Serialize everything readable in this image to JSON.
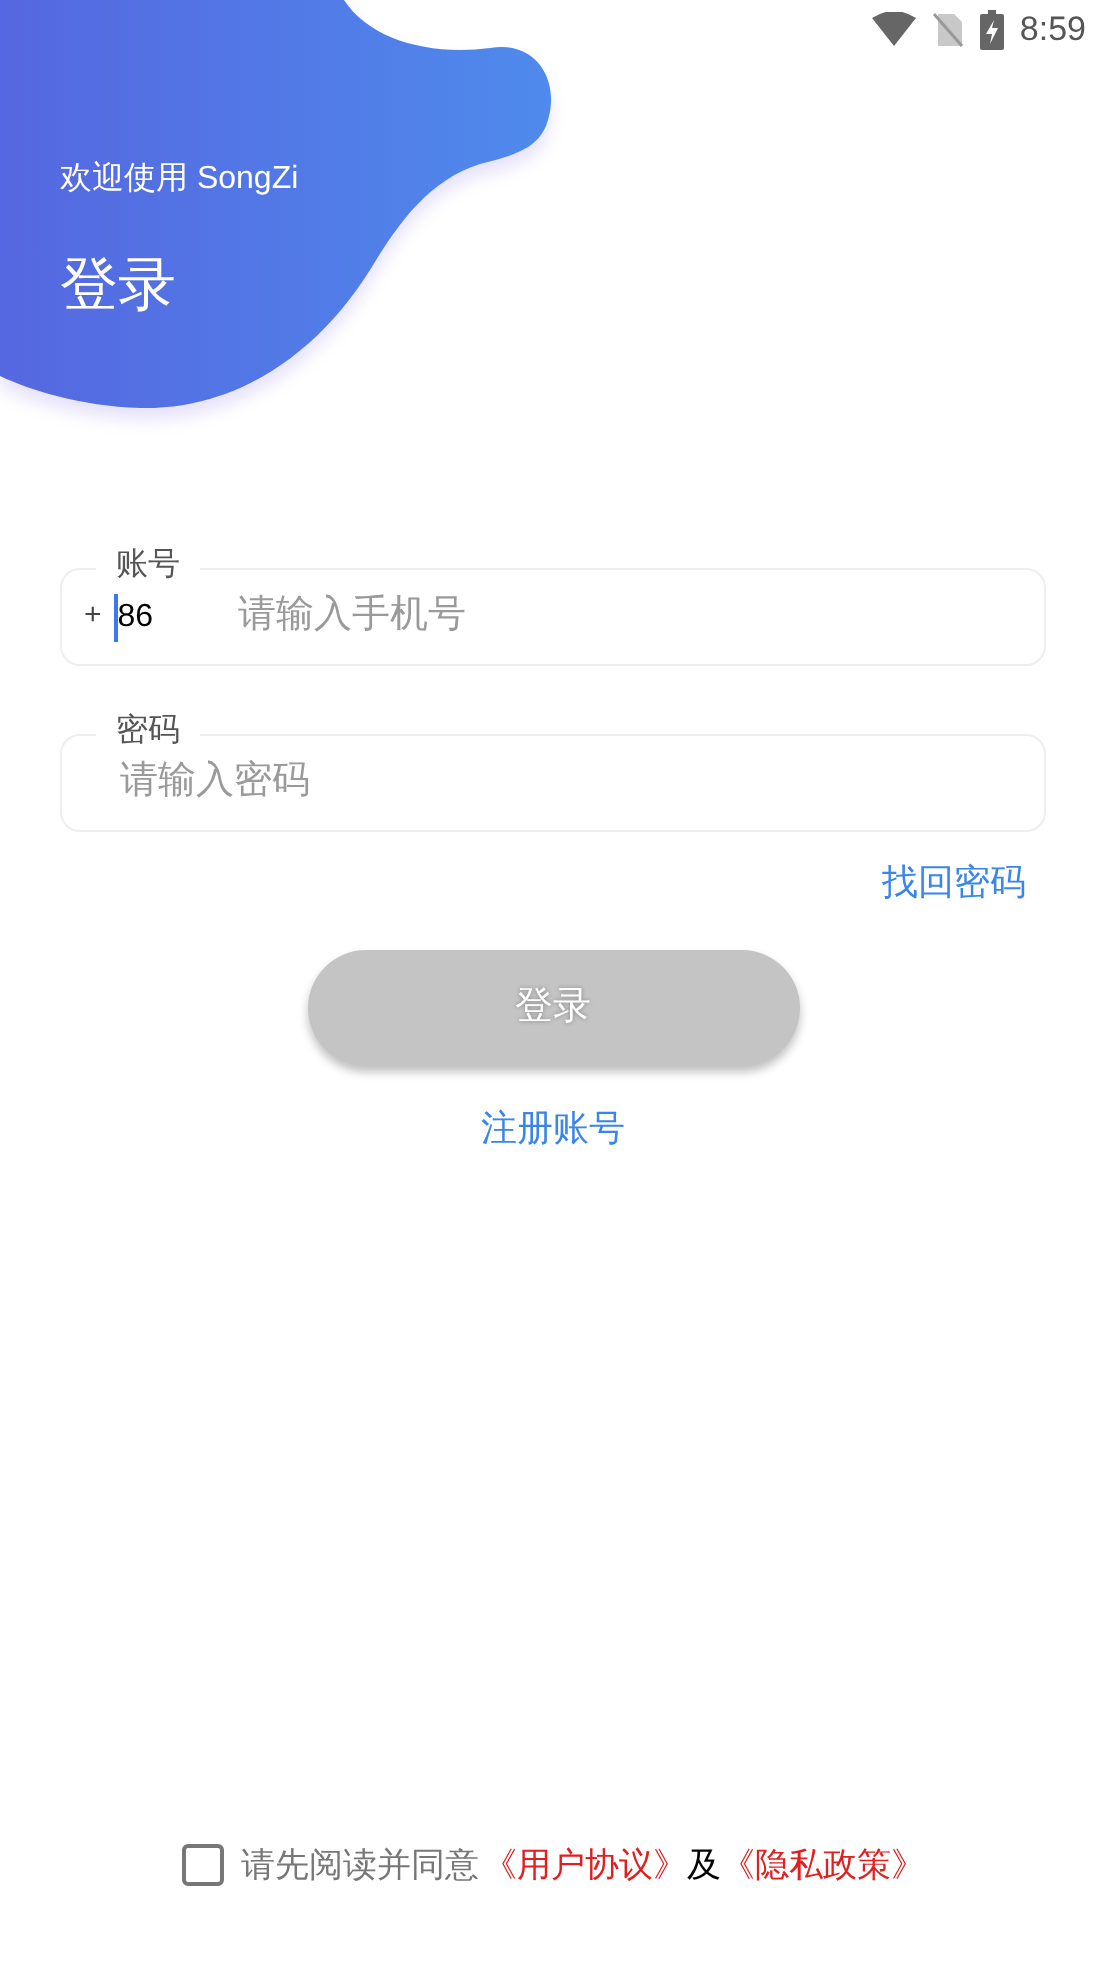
{
  "status_bar": {
    "time": "8:59"
  },
  "header": {
    "greeting": "欢迎使用 SongZi",
    "title": "登录"
  },
  "account_field": {
    "label": "账号",
    "prefix": "+",
    "country_code": "86",
    "placeholder": "请输入手机号"
  },
  "password_field": {
    "label": "密码",
    "placeholder": "请输入密码"
  },
  "forgot_link": "找回密码",
  "login_button": {
    "label": "登录",
    "disabled": true
  },
  "register_link": "注册账号",
  "agreement": {
    "checked": false,
    "parts": [
      {
        "kind": "text",
        "text": "请先阅读并同意"
      },
      {
        "kind": "link",
        "text": "《用户协议》"
      },
      {
        "kind": "plain",
        "text": "及"
      },
      {
        "kind": "link",
        "text": "《隐私政策》"
      }
    ]
  }
}
